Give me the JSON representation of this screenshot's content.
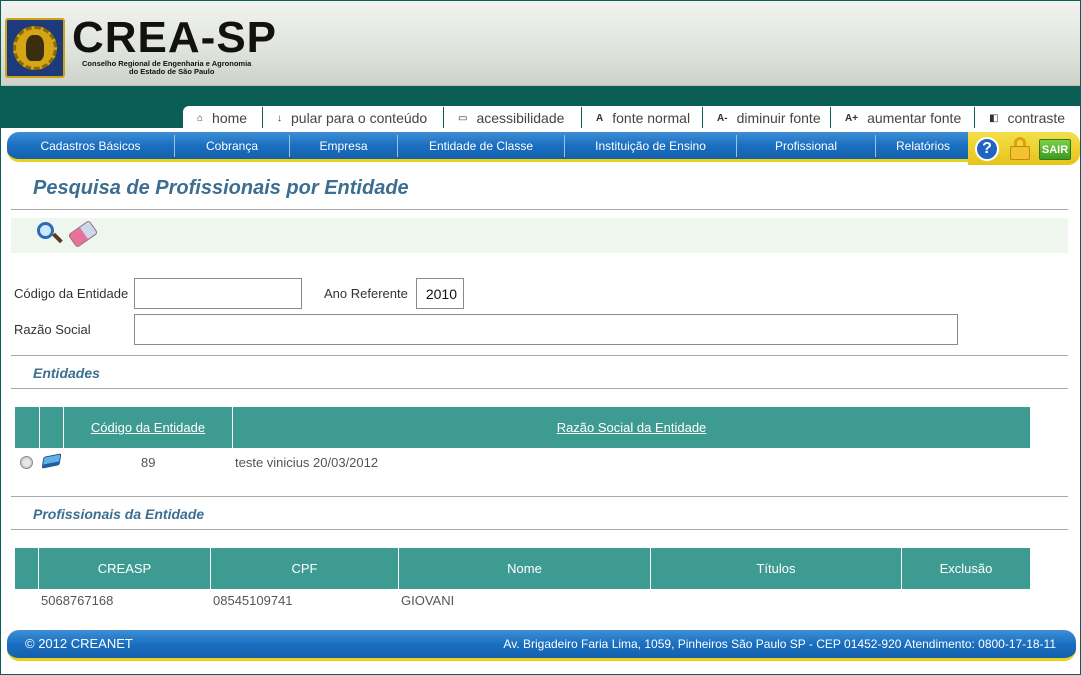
{
  "header": {
    "logo_text": "CREA-SP",
    "logo_sub1": "Conselho Regional de Engenharia e Agronomia",
    "logo_sub2": "do Estado de São Paulo"
  },
  "accessibility": [
    {
      "label": "home",
      "icon": "home-icon",
      "glyph": "⌂"
    },
    {
      "label": "pular para o conteúdo",
      "icon": "arrow-down-icon",
      "glyph": "↓"
    },
    {
      "label": "acessibilidade",
      "icon": "laptop-icon",
      "glyph": "▭"
    },
    {
      "label": "fonte normal",
      "icon": "font-normal-icon",
      "glyph": "A"
    },
    {
      "label": "diminuir fonte",
      "icon": "font-decrease-icon",
      "glyph": "A-"
    },
    {
      "label": "aumentar fonte",
      "icon": "font-increase-icon",
      "glyph": "A+"
    },
    {
      "label": "contraste",
      "icon": "contrast-icon",
      "glyph": "◧"
    }
  ],
  "nav": [
    "Cadastros Básicos",
    "Cobrança",
    "Empresa",
    "Entidade de Classe",
    "Instituição de Ensino",
    "Profissional",
    "Relatórios"
  ],
  "nav_right": {
    "help": "?",
    "logout": "SAIR"
  },
  "page_title": "Pesquisa de Profissionais por Entidade",
  "form": {
    "codigo_label": "Código da Entidade",
    "codigo_value": "",
    "ano_label": "Ano Referente",
    "ano_value": "2010",
    "razao_label": "Razão Social",
    "razao_value": ""
  },
  "entidades": {
    "title": "Entidades",
    "columns": [
      "Código da Entidade",
      "Razão Social da Entidade"
    ],
    "rows": [
      {
        "codigo": "89",
        "razao": "teste vinicius 20/03/2012"
      }
    ]
  },
  "profissionais": {
    "title": "Profissionais da Entidade",
    "columns": [
      "CREASP",
      "CPF",
      "Nome",
      "Títulos",
      "Exclusão"
    ],
    "rows": [
      {
        "creasp": "5068767168",
        "cpf": "08545109741",
        "nome": "GIOVANI",
        "titulos": "",
        "exclusao": ""
      }
    ]
  },
  "footer": {
    "left": "© 2012 CREANET",
    "right": "Av. Brigadeiro Faria Lima, 1059, Pinheiros São Paulo SP - CEP 01452-920 Atendimento: 0800-17-18-11"
  },
  "colors": {
    "teal": "#0b5e55",
    "nav_blue": "#1a6fc0",
    "table_head": "#3e9b92",
    "title": "#3c6e91",
    "accent_yellow": "#e8d21a"
  }
}
